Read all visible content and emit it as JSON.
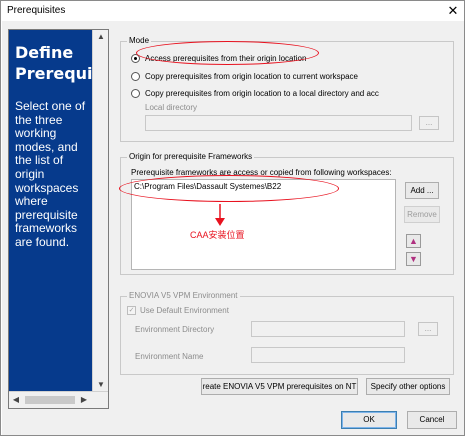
{
  "window": {
    "title": "Prerequisites",
    "close_glyph": "✕"
  },
  "info_panel": {
    "heading_line1": "Define",
    "heading_line2": "Prerequisi",
    "body": "Select one of the three working modes, and the list of origin workspaces where prerequisite frameworks are found.",
    "background_color": "#063a8c"
  },
  "mode": {
    "label": "Mode",
    "options": [
      "Access prerequisites from their origin location",
      "Copy prerequisites from origin location to current workspace",
      "Copy prerequisites from origin location to a local directory and acc"
    ],
    "selected_index": 0,
    "local_directory_label": "Local directory",
    "browse_label": "..."
  },
  "origin": {
    "label": "Origin for prerequisite Frameworks",
    "description": "Prerequisite frameworks are access or copied from following workspaces:",
    "workspaces": [
      "C:\\Program Files\\Dassault Systemes\\B22"
    ],
    "add_label": "Add ...",
    "remove_label": "Remove",
    "up_glyph": "▲",
    "down_glyph": "▼"
  },
  "annotation": {
    "text": "CAA安装位置",
    "color": "#e8121f"
  },
  "enovia": {
    "label": "ENOVIA V5 VPM Environment",
    "use_default_label": "Use Default Environment",
    "use_default_checked": true,
    "env_directory_label": "Environment Directory",
    "env_name_label": "Environment Name",
    "browse_label": "..."
  },
  "buttons": {
    "create_vpm": "reate ENOVIA V5 VPM prerequisites on NT",
    "other_options": "Specify other options",
    "ok": "OK",
    "cancel": "Cancel"
  }
}
